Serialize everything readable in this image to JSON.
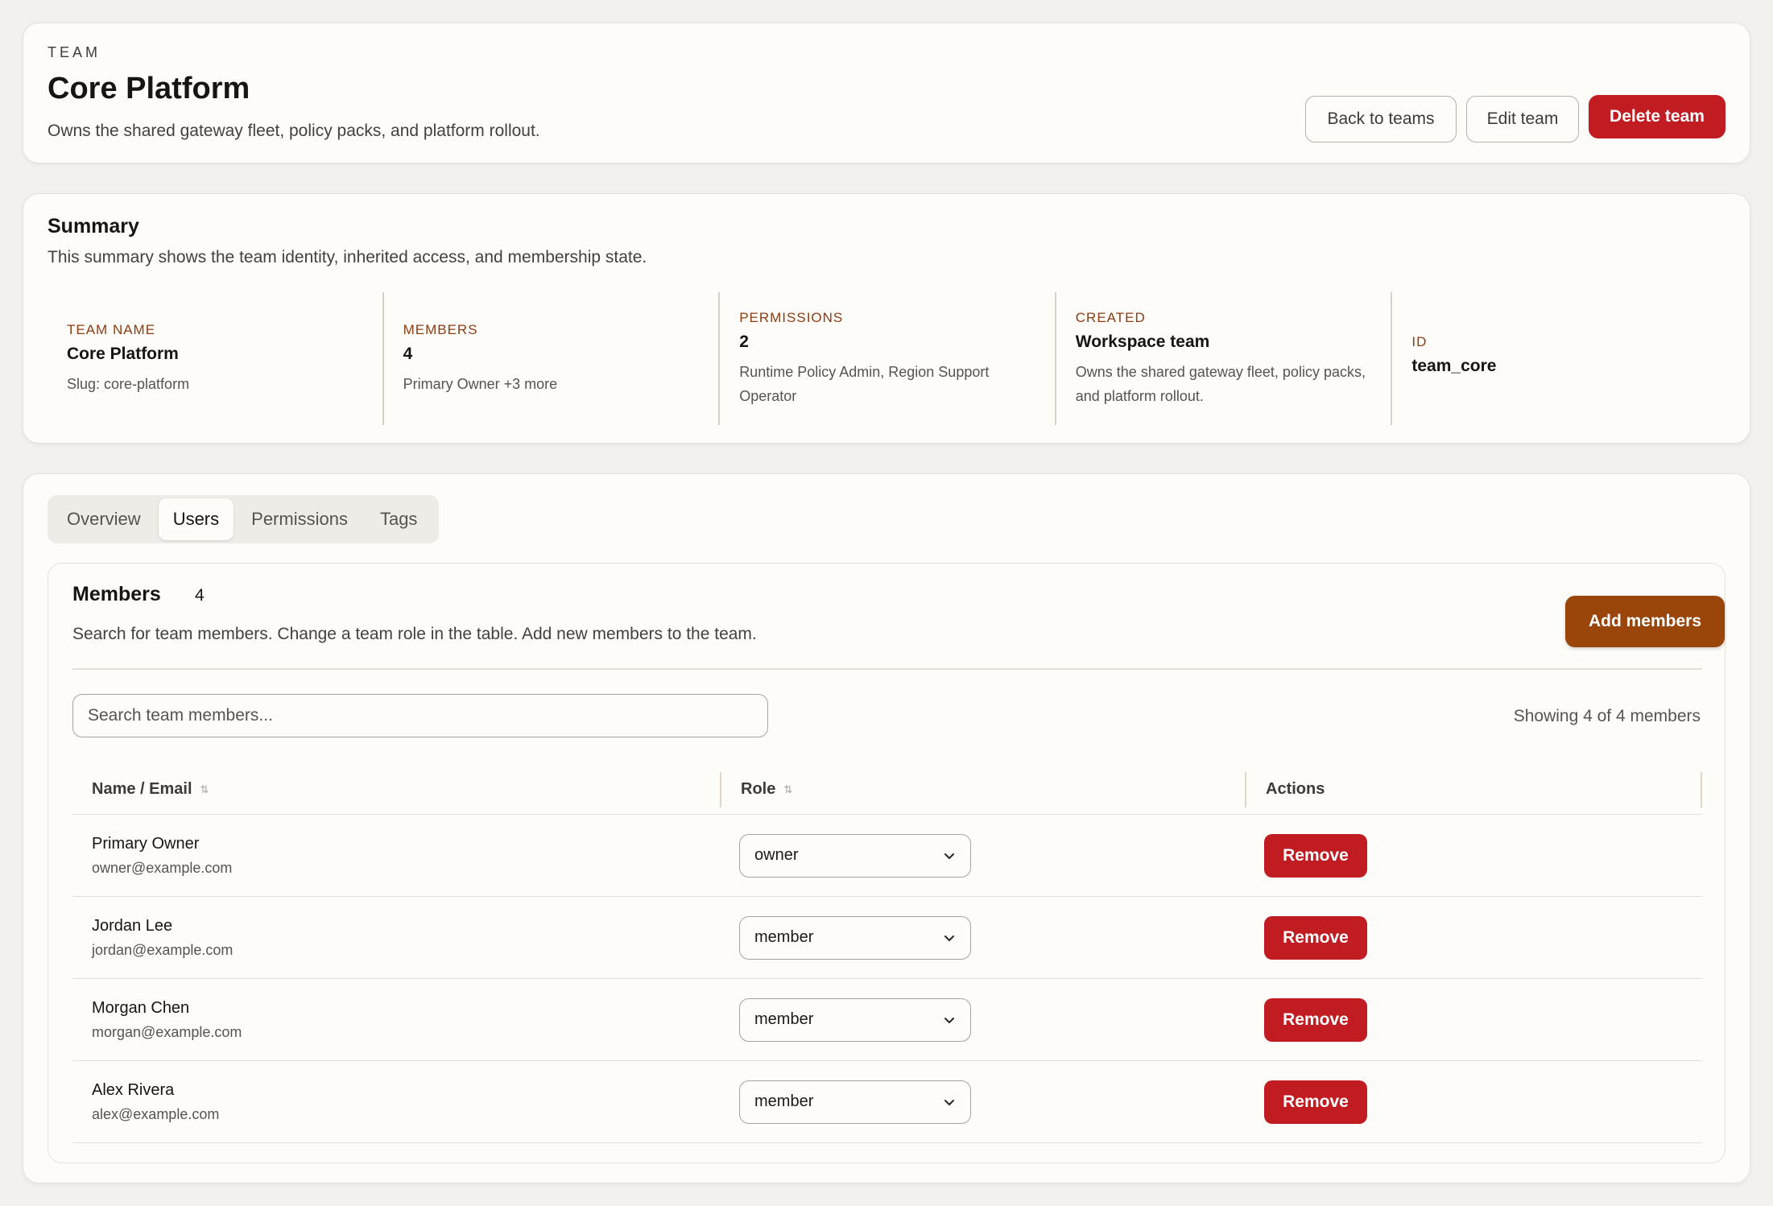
{
  "header": {
    "eyebrow": "TEAM",
    "title": "Core Platform",
    "description": "Owns the shared gateway fleet, policy packs, and platform rollout.",
    "back_label": "Back to teams",
    "edit_label": "Edit team",
    "delete_label": "Delete team"
  },
  "summary": {
    "title": "Summary",
    "description": "This summary shows the team identity, inherited access, and membership state.",
    "cells": [
      {
        "label": "TEAM NAME",
        "value": "Core Platform",
        "sub": "Slug: core-platform"
      },
      {
        "label": "MEMBERS",
        "value": "4",
        "sub": "Primary Owner +3 more"
      },
      {
        "label": "PERMISSIONS",
        "value": "2",
        "sub": "Runtime Policy Admin, Region Support Operator"
      },
      {
        "label": "CREATED",
        "value": "Workspace team",
        "sub": "Owns the shared gateway fleet, policy packs, and platform rollout."
      },
      {
        "label": "ID",
        "value": "team_core",
        "sub": ""
      }
    ]
  },
  "tabs": [
    {
      "label": "Overview",
      "active": false
    },
    {
      "label": "Users",
      "active": true
    },
    {
      "label": "Permissions",
      "active": false
    },
    {
      "label": "Tags",
      "active": false
    }
  ],
  "members": {
    "title": "Members",
    "count": "4",
    "description": "Search for team members. Change a team role in the table. Add new members to the team.",
    "add_label": "Add members",
    "search_placeholder": "Search team members...",
    "showing": "Showing 4 of 4 members",
    "columns": [
      "Name / Email",
      "Role",
      "Actions"
    ],
    "rows": [
      {
        "name": "Primary Owner",
        "email": "owner@example.com",
        "role": "owner",
        "action": "Remove"
      },
      {
        "name": "Jordan Lee",
        "email": "jordan@example.com",
        "role": "member",
        "action": "Remove"
      },
      {
        "name": "Morgan Chen",
        "email": "morgan@example.com",
        "role": "member",
        "action": "Remove"
      },
      {
        "name": "Alex Rivera",
        "email": "alex@example.com",
        "role": "member",
        "action": "Remove"
      }
    ]
  },
  "colors": {
    "danger": "#c01c22",
    "accent": "#9a460a",
    "label": "#8a3c12",
    "background": "#f3f1ee",
    "card": "#fdfcf9"
  }
}
